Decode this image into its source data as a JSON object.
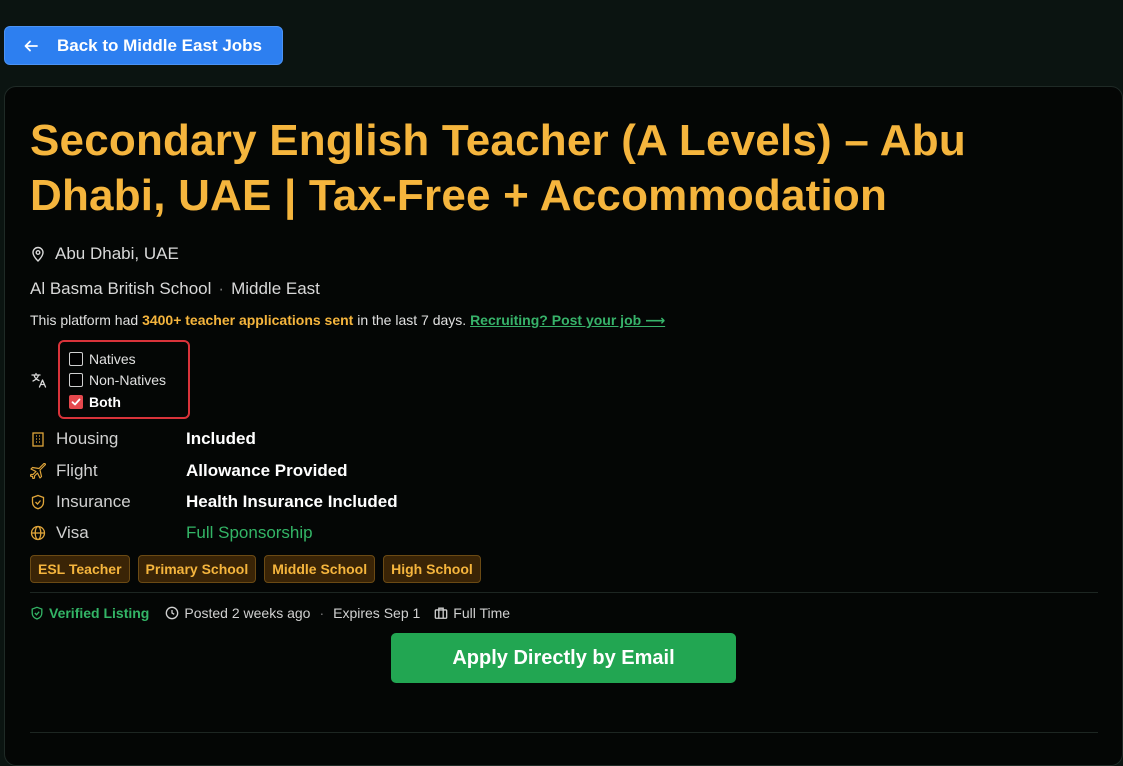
{
  "back_button": {
    "label": "Back to Middle East Jobs",
    "icon": "arrow-left-icon"
  },
  "job": {
    "title": "Secondary English Teacher (A Levels) – Abu Dhabi, UAE | Tax-Free + Accommodation",
    "location": "Abu Dhabi, UAE",
    "school": "Al Basma British School",
    "region": "Middle East"
  },
  "platform": {
    "prefix": "This platform had",
    "highlight": "3400+ teacher applications sent",
    "suffix": "in the last 7 days.",
    "link": "Recruiting? Post your job ⟶"
  },
  "language": {
    "icon": "translate-icon",
    "options": [
      {
        "label": "Natives",
        "checked": false
      },
      {
        "label": "Non-Natives",
        "checked": false
      },
      {
        "label": "Both",
        "checked": true
      }
    ]
  },
  "benefits": [
    {
      "icon": "building-icon",
      "label": "Housing",
      "value": "Included"
    },
    {
      "icon": "plane-icon",
      "label": "Flight",
      "value": "Allowance Provided"
    },
    {
      "icon": "shield-icon",
      "label": "Insurance",
      "value": "Health Insurance Included"
    },
    {
      "icon": "globe-icon",
      "label": "Visa",
      "value": "Full Sponsorship"
    }
  ],
  "tags": [
    "ESL Teacher",
    "Primary School",
    "Middle School",
    "High School"
  ],
  "meta": {
    "verified": "Verified Listing",
    "posted": "Posted 2 weeks ago",
    "expires": "Expires Sep 1",
    "type": "Full Time"
  },
  "apply_button": {
    "label": "Apply Directly by Email"
  },
  "colors": {
    "accent": "#f5b53d",
    "primary_button": "#2d7ff0",
    "apply_button": "#22a652",
    "success": "#33b566",
    "highlight_border": "#d9333a"
  }
}
